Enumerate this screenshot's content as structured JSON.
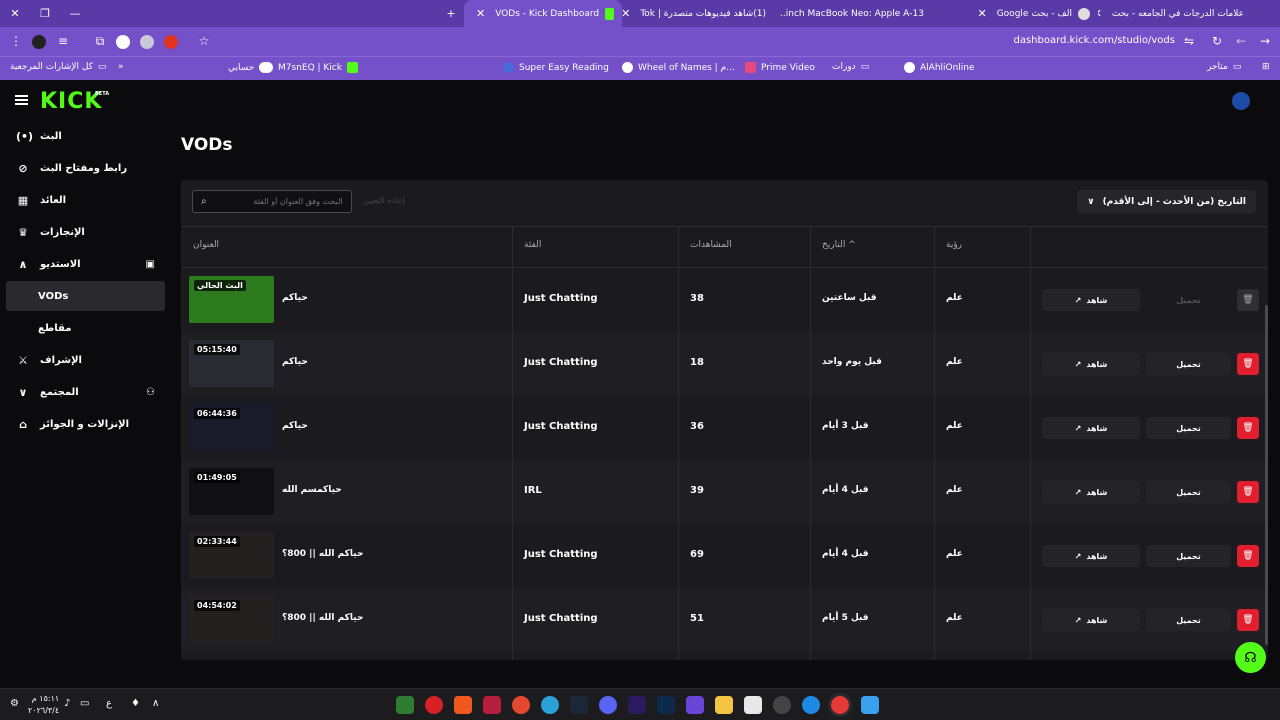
{
  "browser": {
    "tabs": [
      {
        "title": "علامات الدرجات في الجامعه - بحث",
        "active": false
      },
      {
        "title": "الف - بحث Google",
        "active": false
      },
      {
        "title": "13-inch MacBook Neo: Apple A...",
        "active": false
      },
      {
        "title": "(1)شاهد فيديوهات متصدرة | Tok",
        "active": false
      },
      {
        "title": "VODs - Kick Dashboard",
        "active": true
      }
    ],
    "url": "dashboard.kick.com/studio/vods",
    "bookmarks": [
      "كل الإشارات المرجعية",
      "حسابي",
      "M7snEQ | Kick",
      "Super Easy Reading",
      "Wheel of Names | م...",
      "Prime Video",
      "دورات",
      "AlAhliOnline",
      "متاجر"
    ]
  },
  "app": {
    "logo": "KICK",
    "beta": "BETA",
    "page_title": "VODs",
    "sidebar": [
      {
        "label": "البث",
        "icon": "broadcast-icon",
        "active": false,
        "sub": false
      },
      {
        "label": "رابط ومفتاح البث",
        "icon": "link-icon",
        "active": false,
        "sub": false
      },
      {
        "label": "العائد",
        "icon": "chart-icon",
        "active": false,
        "sub": false
      },
      {
        "label": "الإنجازات",
        "icon": "trophy-icon",
        "active": false,
        "sub": false
      },
      {
        "label": "الاستديو",
        "icon": "chevron-up-icon",
        "active": false,
        "sub": false
      },
      {
        "label": "VODs",
        "icon": "",
        "active": true,
        "sub": true
      },
      {
        "label": "مقاطع",
        "icon": "",
        "active": false,
        "sub": true
      },
      {
        "label": "الإشراف",
        "icon": "sword-icon",
        "active": false,
        "sub": false
      },
      {
        "label": "المجتمع",
        "icon": "chevron-down-icon",
        "active": false,
        "sub": false
      },
      {
        "label": "الإنزالات و الجوائز",
        "icon": "gift-icon",
        "active": false,
        "sub": false
      }
    ],
    "search_placeholder": "البحث وفق العنوان أو الفئة",
    "bulk_delete": "إعادة التعيين",
    "sort_label": "التاريخ (من الأحدث - إلى الأقدم)",
    "columns": {
      "title": "العنوان",
      "category": "الفئة",
      "views": "المشاهدات",
      "date": "التاريخ",
      "visibility": "رؤية"
    },
    "watch_label": "شاهد",
    "download_label": "تحميل",
    "vods": [
      {
        "title": "حياكم",
        "duration": "البث الحالي",
        "category": "Just Chatting",
        "views": "38",
        "date": "قبل ساعتين",
        "visibility": "علم",
        "thumb": "#2e7a1e",
        "download_enabled": false
      },
      {
        "title": "حياكم",
        "duration": "05:15:40",
        "category": "Just Chatting",
        "views": "18",
        "date": "قبل يوم واحد",
        "visibility": "علم",
        "thumb": "#2a2a33",
        "download_enabled": true
      },
      {
        "title": "حياكم",
        "duration": "06:44:36",
        "category": "Just Chatting",
        "views": "36",
        "date": "قبل 3 أيام",
        "visibility": "علم",
        "thumb": "#1a1a2a",
        "download_enabled": true
      },
      {
        "title": "حياكمسم الله",
        "duration": "01:49:05",
        "category": "IRL",
        "views": "39",
        "date": "قبل 4 أيام",
        "visibility": "علم",
        "thumb": "#111114",
        "download_enabled": true
      },
      {
        "title": "حياكم الله || 800؟",
        "duration": "02:33:44",
        "category": "Just Chatting",
        "views": "69",
        "date": "قبل 4 أيام",
        "visibility": "علم",
        "thumb": "#232020",
        "download_enabled": true
      },
      {
        "title": "حياكم الله || 800؟",
        "duration": "04:54:02",
        "category": "Just Chatting",
        "views": "51",
        "date": "قبل 5 أيام",
        "visibility": "علم",
        "thumb": "#232020",
        "download_enabled": true
      }
    ]
  },
  "taskbar": {
    "time": "١٥:١١ م",
    "date": "٢٠٢٦/٣/٤"
  },
  "colors": {
    "kick_green": "#53fc18",
    "delete_red": "#e01e2e",
    "browser_purple": "#7450c9"
  }
}
